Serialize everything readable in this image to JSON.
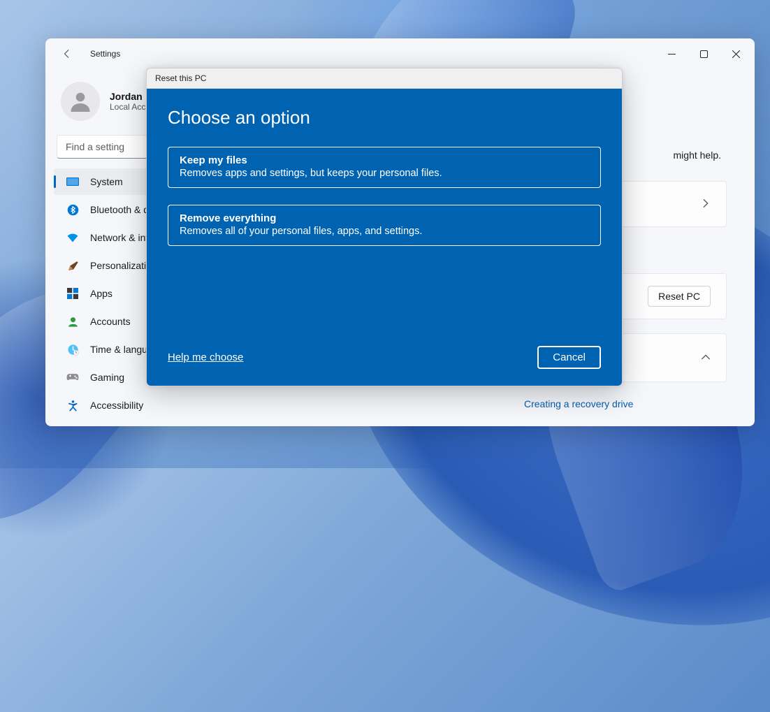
{
  "window": {
    "title": "Settings"
  },
  "user": {
    "name": "Jordan",
    "subtitle": "Local Account"
  },
  "search": {
    "placeholder": "Find a setting"
  },
  "nav": {
    "system": "System",
    "bluetooth": "Bluetooth & devices",
    "network": "Network & internet",
    "personalization": "Personalization",
    "apps": "Apps",
    "accounts": "Accounts",
    "time": "Time & language",
    "gaming": "Gaming",
    "accessibility": "Accessibility"
  },
  "main": {
    "hint_suffix": "might help.",
    "reset_pc_button": "Reset PC",
    "recovery_link": "Creating a recovery drive"
  },
  "modal": {
    "header": "Reset this PC",
    "title": "Choose an option",
    "option1": {
      "title": "Keep my files",
      "desc": "Removes apps and settings, but keeps your personal files."
    },
    "option2": {
      "title": "Remove everything",
      "desc": "Removes all of your personal files, apps, and settings."
    },
    "help": "Help me choose",
    "cancel": "Cancel"
  }
}
